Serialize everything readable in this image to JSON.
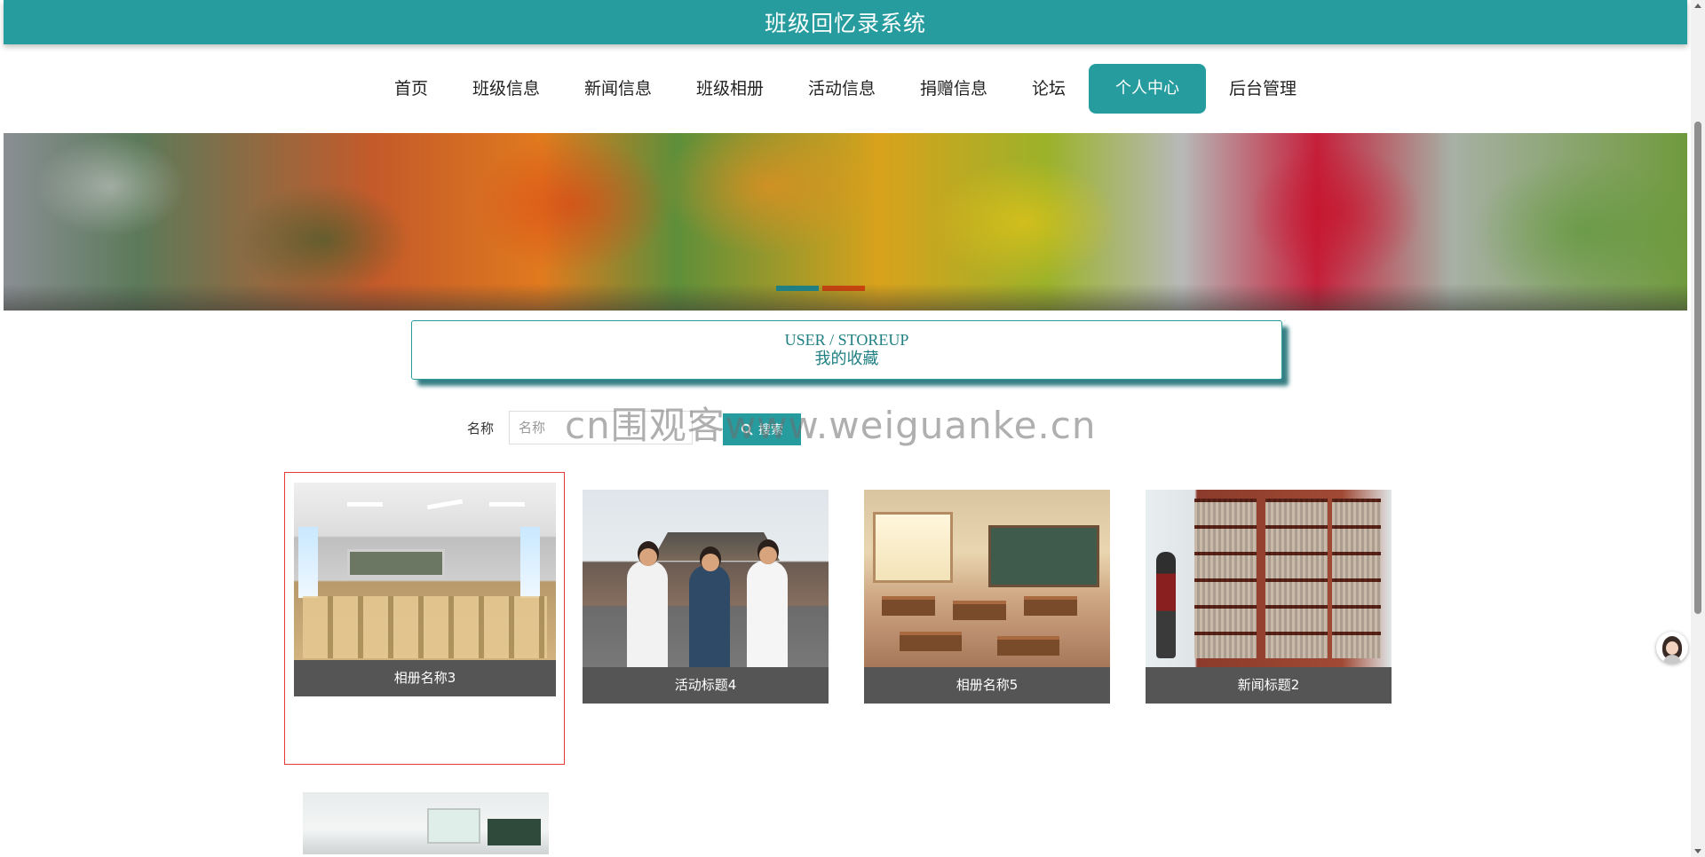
{
  "header": {
    "title": "班级回忆录系统"
  },
  "nav": {
    "items": [
      {
        "label": "首页"
      },
      {
        "label": "班级信息"
      },
      {
        "label": "新闻信息"
      },
      {
        "label": "班级相册"
      },
      {
        "label": "活动信息"
      },
      {
        "label": "捐赠信息"
      },
      {
        "label": "论坛"
      },
      {
        "label": "个人中心",
        "active": true
      },
      {
        "label": "后台管理"
      }
    ]
  },
  "banner": {
    "dots_count": 2,
    "active_dot": 0
  },
  "section": {
    "en_title": "USER / STOREUP",
    "cn_title": "我的收藏"
  },
  "search": {
    "label": "名称",
    "placeholder": "名称",
    "value": "",
    "button_label": "搜索"
  },
  "watermark": {
    "text": "cn围观客www.weiguanke.cn"
  },
  "favorites": [
    {
      "title": "相册名称3",
      "image": "classroom"
    },
    {
      "title": "活动标题4",
      "image": "students"
    },
    {
      "title": "相册名称5",
      "image": "empty-classroom"
    },
    {
      "title": "新闻标题2",
      "image": "library"
    },
    {
      "title": "",
      "image": "lecture-room"
    }
  ],
  "colors": {
    "primary": "#279c9f",
    "caption_bg": "#555555",
    "hover_border": "#e53935"
  }
}
